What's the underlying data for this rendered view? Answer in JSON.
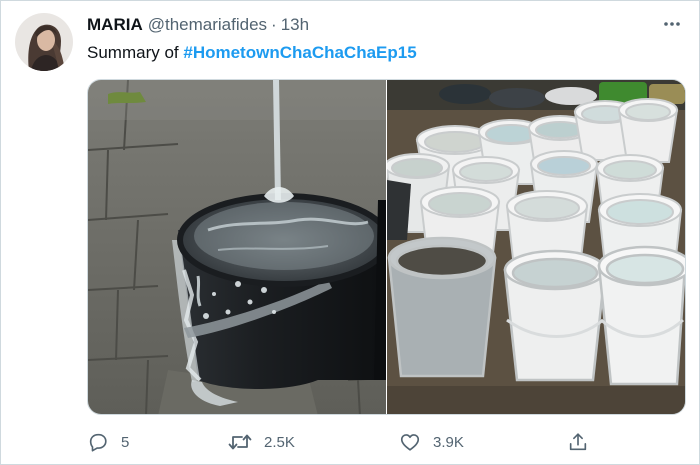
{
  "tweet": {
    "display_name": "MARIA",
    "handle": "@themariafides",
    "separator": "·",
    "time": "13h",
    "text_prefix": "Summary of ",
    "hashtag": "#HometownChaChaChaEp15"
  },
  "actions": {
    "reply_count": "5",
    "retweet_count": "2.5K",
    "like_count": "3.9K"
  },
  "icons": {
    "more": "more-horizontal-icon",
    "reply": "reply-bubble-icon",
    "retweet": "retweet-icon",
    "like": "heart-icon",
    "share": "share-upload-icon"
  },
  "colors": {
    "accent": "#1d9bf0",
    "text": "#0f1419",
    "muted": "#536471",
    "border": "#cfd9de"
  }
}
